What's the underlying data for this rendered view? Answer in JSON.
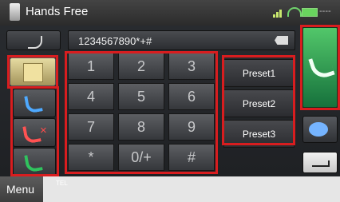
{
  "app": {
    "title": "Hands Free",
    "time": "----"
  },
  "input": {
    "value": "1234567890*+#"
  },
  "keypad": [
    "1",
    "2",
    "3",
    "4",
    "5",
    "6",
    "7",
    "8",
    "9",
    "*",
    "0/+",
    "#"
  ],
  "presets": [
    "Preset1",
    "Preset2",
    "Preset3"
  ],
  "bottom": {
    "menu": "Menu",
    "tel": "TEL"
  }
}
